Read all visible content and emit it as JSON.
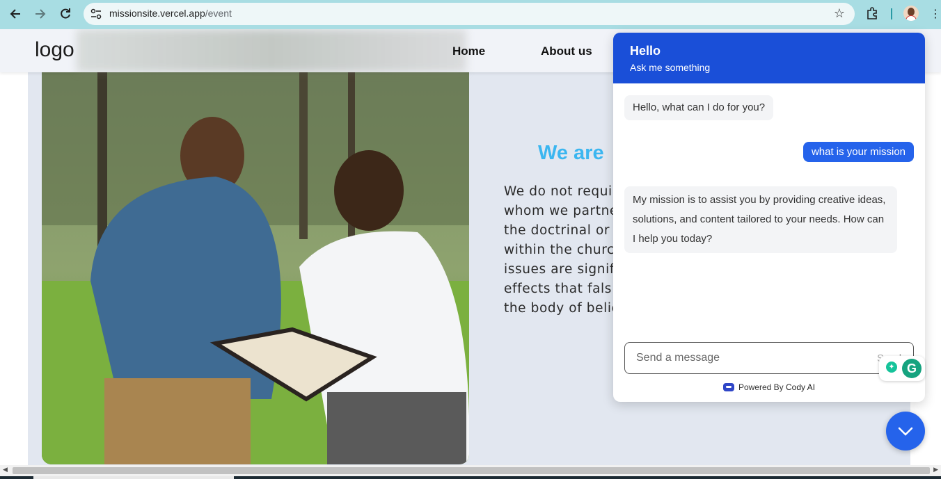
{
  "browser": {
    "url_host": "missionsite.vercel.app",
    "url_path": "/event"
  },
  "site": {
    "logo": "logo",
    "nav": [
      "Home",
      "About us"
    ],
    "hero_title": "We are",
    "hero_lines": [
      "We do not requi",
      "whom we partne",
      "the doctrinal or",
      "within the churc",
      "issues are signif",
      "effects that fals",
      "the body of belie"
    ]
  },
  "chat": {
    "title": "Hello",
    "subtitle": "Ask me something",
    "messages": [
      {
        "role": "bot",
        "text": "Hello, what can I do for you?"
      },
      {
        "role": "user",
        "text": "what is your mission"
      },
      {
        "role": "bot",
        "text": "My mission is to assist you by providing creative ideas, solutions, and content tailored to your needs. How can I help you today?"
      }
    ],
    "input_placeholder": "Send a message",
    "send_label": "Send",
    "powered_prefix": "Powered By",
    "powered_brand": "Cody AI"
  },
  "colors": {
    "browser_bar": "#a8dde3",
    "chat_header": "#1a4fd8",
    "user_bubble": "#2563eb",
    "hero_title": "#3bb6f0"
  },
  "icons": [
    "back-arrow-icon",
    "forward-arrow-icon",
    "reload-icon",
    "site-info-icon",
    "star-icon",
    "extensions-icon",
    "profile-avatar-icon",
    "more-menu-icon",
    "cody-logo-icon",
    "grammarly-icon",
    "chevron-down-icon"
  ]
}
